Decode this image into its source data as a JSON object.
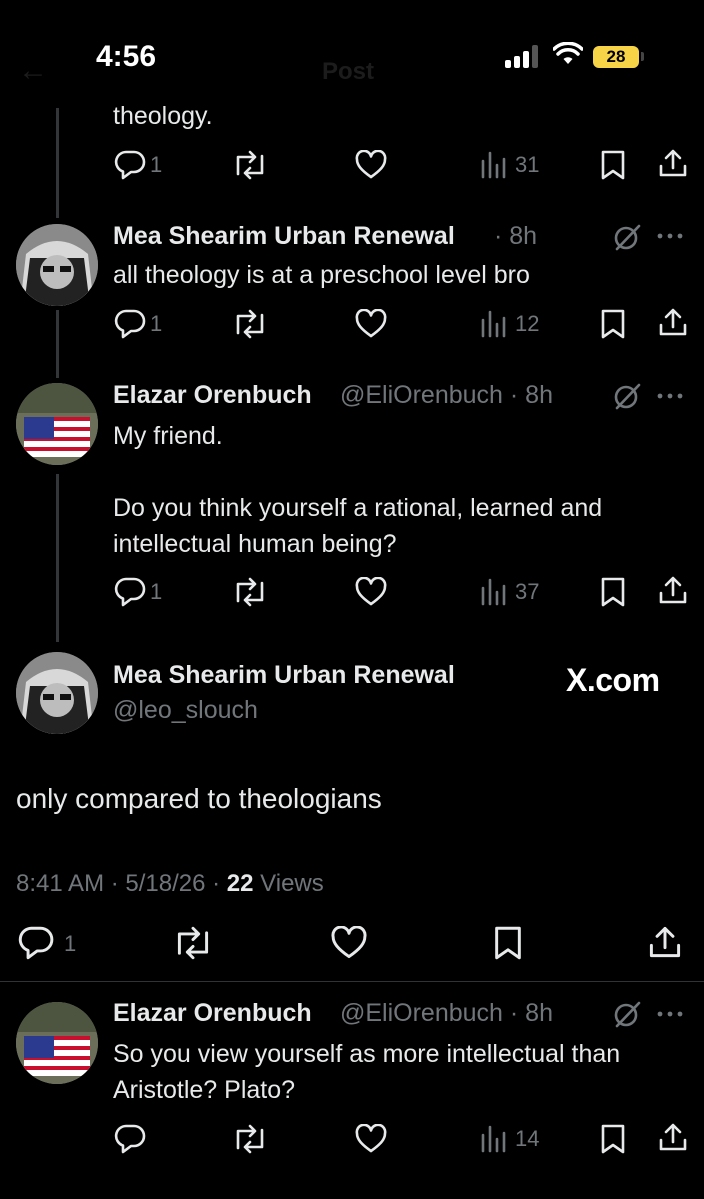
{
  "status_bar": {
    "time": "4:56",
    "battery": "28"
  },
  "header": {
    "title": "Post"
  },
  "top_reply": {
    "text_tail": "theology.",
    "replies": "1",
    "views": "31"
  },
  "reply1": {
    "name": "Mea Shearim Urban Renewal",
    "meta": "· 8h",
    "text": "all theology is at a preschool level bro",
    "replies": "1",
    "views": "12"
  },
  "reply2": {
    "name": "Elazar Orenbuch",
    "meta": "@EliOrenbuch · 8h",
    "text": "My friend.\n\nDo you think yourself a rational, learned and intellectual human being?",
    "replies": "1",
    "views": "37"
  },
  "main_post": {
    "name": "Mea Shearim Urban Renewal",
    "handle": "@leo_slouch",
    "watermark": "X.com",
    "text": "only compared to theologians",
    "time": "8:41 AM",
    "date": "5/18/26",
    "views_count": "22",
    "views_label": "Views",
    "replies": "1"
  },
  "reply3": {
    "name": "Elazar Orenbuch",
    "meta": "@EliOrenbuch · 8h",
    "text": "So you view yourself as more intellectual than Aristotle? Plato?",
    "views": "14"
  },
  "colors": {
    "background": "#000000",
    "text": "#e7e9ea",
    "muted": "#71767b",
    "divider": "#2f3336"
  }
}
